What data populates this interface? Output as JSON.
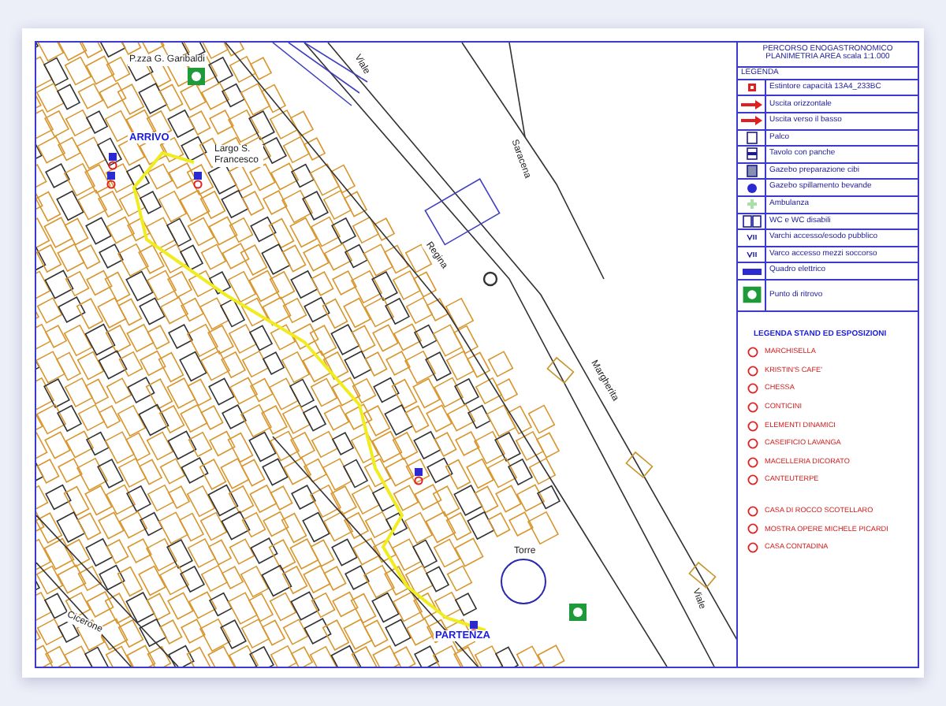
{
  "map": {
    "labels": [
      {
        "kind": "place",
        "text": "P.zza G. Garibaldi"
      },
      {
        "kind": "street",
        "text": "Viale"
      },
      {
        "kind": "marker",
        "text": "ARRIVO"
      },
      {
        "kind": "place",
        "text": "Largo S. Francesco"
      },
      {
        "kind": "street",
        "text": "Saracena"
      },
      {
        "kind": "street",
        "text": "Regina"
      },
      {
        "kind": "street",
        "text": "Margherita"
      },
      {
        "kind": "place",
        "text": "Torre"
      },
      {
        "kind": "marker",
        "text": "PARTENZA"
      },
      {
        "kind": "street",
        "text": "Viale"
      },
      {
        "kind": "street",
        "text": "Cicerone"
      }
    ]
  },
  "legend": {
    "title_lines": [
      "PERCORSO ENOGASTRONOMICO",
      "PLANIMETRIA AREA scala 1:1.000"
    ],
    "heading": "LEGENDA",
    "items": [
      {
        "kind": "extinguisher",
        "label": "Estintore capacità 13A4_233BC"
      },
      {
        "kind": "exit_horizontal",
        "label": "Uscita orizzontale"
      },
      {
        "kind": "exit_down",
        "label": "Uscita verso il basso"
      },
      {
        "kind": "stage",
        "label": "Palco"
      },
      {
        "kind": "table",
        "label": "Tavolo con panche"
      },
      {
        "kind": "gazebo_food",
        "label": "Gazebo preparazione cibi"
      },
      {
        "kind": "gazebo_drinks",
        "label": "Gazebo spillamento bevande"
      },
      {
        "kind": "ambulance",
        "label": "Ambulanza"
      },
      {
        "kind": "wc",
        "label": "WC e WC disabili"
      },
      {
        "kind": "gate_public",
        "label": "Varchi accesso/esodo pubblico"
      },
      {
        "kind": "gate_rescue",
        "label": "Varco accesso mezzi soccorso"
      },
      {
        "kind": "electric",
        "label": "Quadro elettrico"
      },
      {
        "kind": "meeting_point",
        "label": "Punto di ritrovo"
      }
    ]
  },
  "stand_legend": {
    "heading": "LEGENDA STAND ED ESPOSIZIONI",
    "groups": [
      [
        "MARCHISELLA",
        "KRISTIN'S CAFE'",
        "CHESSA",
        "CONTICINI",
        "ELEMENTI DINAMICI",
        "CASEIFICIO LAVANGA",
        "MACELLERIA DICORATO",
        "CANTEUTERPE"
      ],
      [
        "CASA DI ROCCO SCOTELLARO",
        "MOSTRA OPERE MICHELE PICARDI",
        "CASA CONTADINA"
      ]
    ]
  }
}
